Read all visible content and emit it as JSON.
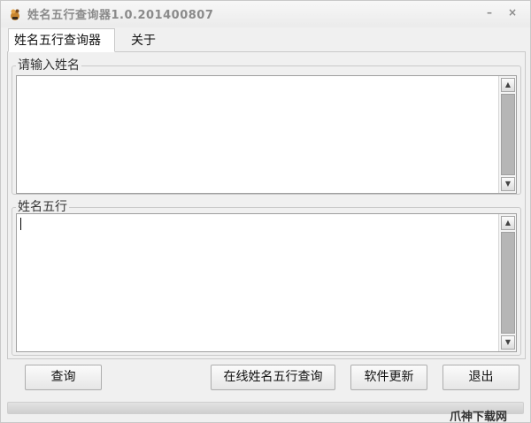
{
  "window": {
    "title": "姓名五行查询器1.0.201400807",
    "minimize_glyph": "–",
    "close_glyph": "×",
    "app_icon": "app-icon"
  },
  "tabs": [
    {
      "label": "姓名五行查询器",
      "active": true
    },
    {
      "label": "关于",
      "active": false
    }
  ],
  "input_group": {
    "title": "请输入姓名",
    "value": ""
  },
  "result_group": {
    "title": "姓名五行",
    "value": ""
  },
  "buttons": {
    "query": "查询",
    "online_query": "在线姓名五行查询",
    "update": "软件更新",
    "exit": "退出"
  },
  "watermark": "爪神下载网",
  "colors": {
    "window_bg": "#f0f0f0",
    "title_text": "#8a8a8a",
    "scroll_thumb": "#b6b6b6"
  }
}
